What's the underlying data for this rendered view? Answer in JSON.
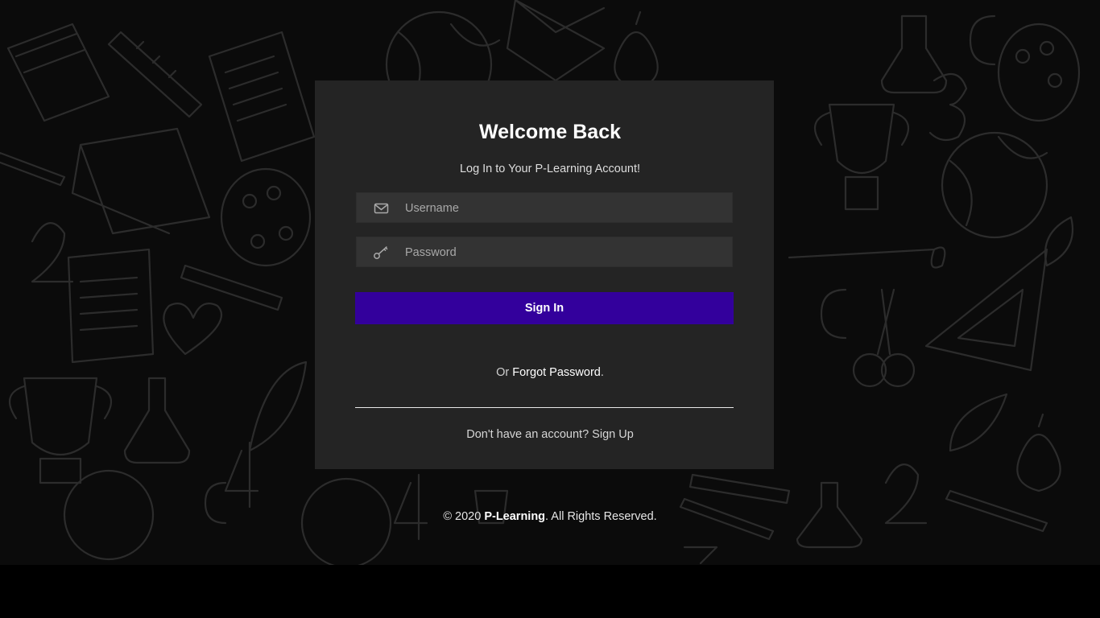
{
  "login": {
    "title": "Welcome Back",
    "subtitle": "Log In to Your P-Learning Account!",
    "username_placeholder": "Username",
    "password_placeholder": "Password",
    "username_icon": "envelope-icon",
    "password_icon": "key-icon",
    "submit_label": "Sign In",
    "forgot_prefix": "Or ",
    "forgot_link": "Forgot Password",
    "forgot_suffix": ".",
    "signup_prompt": "Don't have an account? ",
    "signup_link": "Sign Up"
  },
  "footer": {
    "prefix": "© 2020 ",
    "brand": "P-Learning",
    "suffix": ". All Rights Reserved."
  },
  "colors": {
    "page_bg": "#000000",
    "card_bg": "#242424",
    "input_bg": "#333333",
    "accent": "#33009c"
  }
}
